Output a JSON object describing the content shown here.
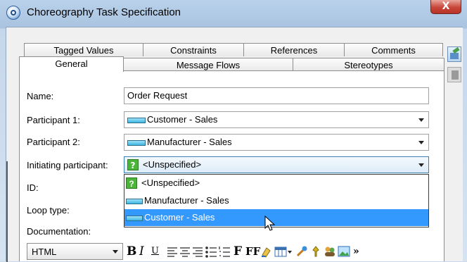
{
  "window": {
    "title": "Choreography Task Specification",
    "close_label": "X"
  },
  "tabs_back": [
    "Tagged Values",
    "Constraints",
    "References",
    "Comments"
  ],
  "tabs_front": [
    "General",
    "Message Flows",
    "Stereotypes"
  ],
  "active_tab": "General",
  "form": {
    "name_label": "Name:",
    "name_value": "Order Request",
    "participant1_label": "Participant 1:",
    "participant1_value": "Customer - Sales",
    "participant2_label": "Participant 2:",
    "participant2_value": "Manufacturer - Sales",
    "initiating_label": "Initiating participant:",
    "initiating_value": "<Unspecified>",
    "id_label": "ID:",
    "loop_label": "Loop type:",
    "documentation_label": "Documentation:"
  },
  "dropdown": {
    "options": [
      "<Unspecified>",
      "Manufacturer - Sales",
      "Customer - Sales"
    ],
    "highlighted": "Customer - Sales"
  },
  "toolbar": {
    "format_value": "HTML",
    "bold": "B",
    "italic": "I",
    "underline": "U",
    "font": "F",
    "font_size": "FF",
    "more": "»",
    "icons": [
      "align-left-icon",
      "align-center-icon",
      "align-right-icon",
      "bullet-list-icon",
      "numbered-list-icon",
      "font-icon",
      "font-size-icon",
      "highlight-icon",
      "table-icon",
      "link-icon",
      "pin-icon",
      "users-icon",
      "image-icon",
      "more-icon"
    ]
  },
  "colors": {
    "selection": "#3399ff",
    "close": "#c7473a",
    "frame": "#b9d1ea"
  }
}
